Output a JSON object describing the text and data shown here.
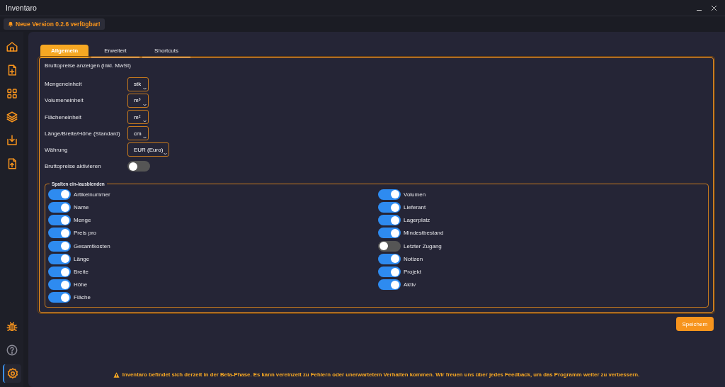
{
  "window": {
    "title": "Inventaro"
  },
  "update_badge": {
    "text": "Neue Version 0.2.6 verfügbar!"
  },
  "sidebar": {
    "items": [
      {
        "selected": false
      },
      {
        "selected": false
      },
      {
        "selected": false
      },
      {
        "selected": false
      },
      {
        "selected": false
      },
      {
        "selected": false
      }
    ],
    "bottom_items": [
      {
        "selected": false
      },
      {
        "selected": false
      },
      {
        "selected": true
      }
    ]
  },
  "tabs": [
    {
      "label": "Allgemein",
      "selected": true
    },
    {
      "label": "Erweitert",
      "selected": false
    },
    {
      "label": "Shortcuts",
      "selected": false
    }
  ],
  "settings": {
    "heading": "Bruttopreise anzeigen (inkl. MwSt)",
    "rows": [
      {
        "kind": "select",
        "label": "Mengeneinheit",
        "value": "stk"
      },
      {
        "kind": "select",
        "label": "Volumeneinheit",
        "value": "m³"
      },
      {
        "kind": "select",
        "label": "Flächeneinheit",
        "value": "m²"
      },
      {
        "kind": "select",
        "label": "Länge/Breite/Höhe (Standard)",
        "value": "cm"
      },
      {
        "kind": "select",
        "label": "Währung",
        "value": "EUR (Euro)"
      },
      {
        "kind": "toggle",
        "label": "Bruttopreise aktivieren",
        "on": false
      }
    ]
  },
  "columns_group": {
    "legend": "Spalten ein-/ausblenden",
    "left": [
      {
        "label": "Artikelnummer",
        "on": true
      },
      {
        "label": "Name",
        "on": true
      },
      {
        "label": "Menge",
        "on": true
      },
      {
        "label": "Preis pro",
        "on": true
      },
      {
        "label": "Gesamtkosten",
        "on": true
      },
      {
        "label": "Länge",
        "on": true
      },
      {
        "label": "Breite",
        "on": true
      },
      {
        "label": "Höhe",
        "on": true
      },
      {
        "label": "Fläche",
        "on": true
      }
    ],
    "right": [
      {
        "label": "Volumen",
        "on": true
      },
      {
        "label": "Lieferant",
        "on": true
      },
      {
        "label": "Lagerplatz",
        "on": true
      },
      {
        "label": "Mindestbestand",
        "on": true
      },
      {
        "label": "Letzter Zugang",
        "on": false
      },
      {
        "label": "Notizen",
        "on": true
      },
      {
        "label": "Projekt",
        "on": true
      },
      {
        "label": "Aktiv",
        "on": true
      }
    ]
  },
  "save_button": "Speichern",
  "footer": {
    "notice": "Inventaro befindet sich derzeit in der Beta-Phase. Es kann vereinzelt zu Fehlern oder unerwartetem Verhalten kommen. Wir freuen uns über jedes Feedback, um das Programm weiter zu verbessern."
  }
}
